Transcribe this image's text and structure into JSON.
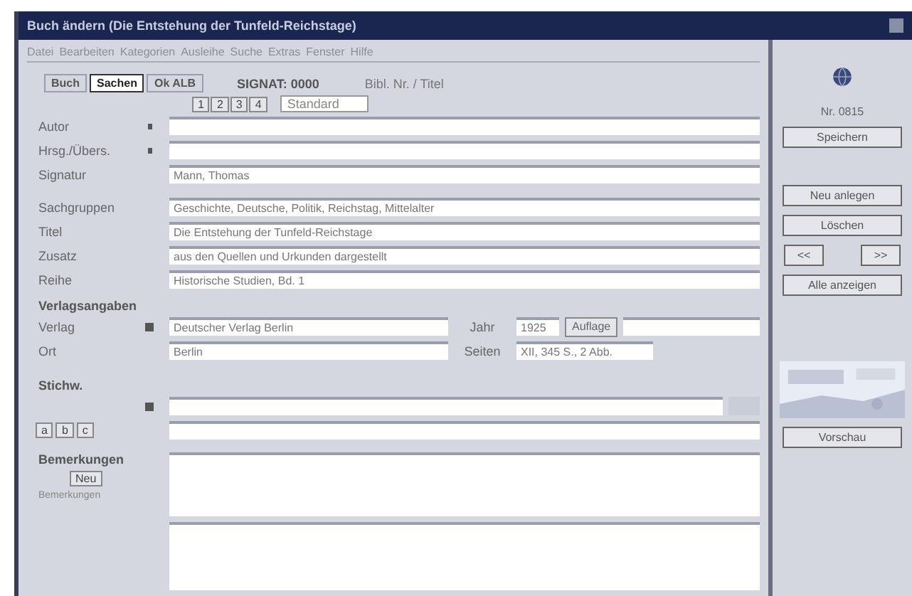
{
  "window": {
    "title": "Buch ändern (Die Entstehung der Tunfeld-Reichstage)"
  },
  "menu": [
    "Datei",
    "Bearbeiten",
    "Kategorien",
    "Ausleihe",
    "Suche",
    "Extras",
    "Fenster",
    "Hilfe"
  ],
  "tabs": [
    {
      "label": "Buch",
      "selected": false
    },
    {
      "label": "Sachen",
      "selected": true
    },
    {
      "label": "Ok ALB",
      "selected": false
    }
  ],
  "signature": "SIGNAT: 0000",
  "record_hint": "Bibl. Nr. / Titel",
  "format_buttons": [
    "1",
    "2",
    "3",
    "4"
  ],
  "format_select": "Standard",
  "fields": [
    {
      "label": "Autor",
      "required": true
    },
    {
      "label": "Hrsg./Übers.",
      "required": true
    },
    {
      "label": "Signatur",
      "required": false,
      "value": "Mann, Thomas"
    },
    {
      "label": "Sachgruppen",
      "required": false,
      "value": "Geschichte, Deutsche, Politik, Reichstag, Mittelalter"
    },
    {
      "label": "Titel",
      "required": false,
      "value": "Die Entstehung der Tunfeld-Reichstage"
    },
    {
      "label": "Zusatz",
      "required": false,
      "value": "aus den Quellen und Urkunden dargestellt"
    },
    {
      "label": "Reihe",
      "required": false,
      "value": "Historische Studien, Bd. 1"
    }
  ],
  "publisher": {
    "section": "Verlagsangaben",
    "rows": [
      {
        "label": "Verlag",
        "value": "Deutscher Verlag Berlin",
        "side_label": "Jahr",
        "side_value": "1925",
        "side_button": "Auflage"
      },
      {
        "label": "Ort",
        "value": "Berlin",
        "side_label": "Seiten",
        "side_value": "XII, 345 S., 2 Abb."
      }
    ]
  },
  "keywords": {
    "section": "Stichw.",
    "small_buttons": [
      "a",
      "b",
      "c"
    ]
  },
  "notes": {
    "section": "Bemerkungen",
    "button": "Neu",
    "hint": "Bemerkungen"
  },
  "side": {
    "number": "Nr. 0815",
    "buttons": [
      "Speichern",
      "Neu anlegen",
      "Löschen"
    ],
    "nav": [
      "<<",
      ">>"
    ],
    "all_button": "Alle anzeigen",
    "preview_button": "Vorschau"
  }
}
